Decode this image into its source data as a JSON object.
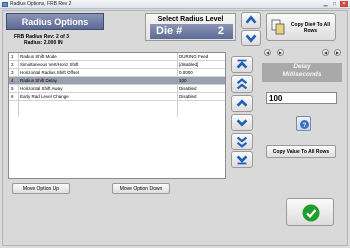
{
  "window": {
    "title": "Radius Options, FRB Rev 2"
  },
  "header": {
    "title": "Radius Options",
    "rev_line": "FRB Radius Rev:  2 of 3",
    "radius_line": "Radius:  2.000 IN"
  },
  "die_selector": {
    "label": "Select Radius Level",
    "prefix": "Die #",
    "value": "2"
  },
  "copy_die": {
    "label": "Copy Die# To All Rows"
  },
  "table": {
    "rows": [
      {
        "num": "1",
        "name": "Radius Shift Mode",
        "value": "DURING Feed"
      },
      {
        "num": "2",
        "name": "Simultaneous Vert/Horiz Shift",
        "value": "[disabled]"
      },
      {
        "num": "3",
        "name": "Horizontal Radius Shift Offset",
        "value": "0.0000"
      },
      {
        "num": "4",
        "name": "Radius Shift Delay",
        "value": "100",
        "selected": true
      },
      {
        "num": "5",
        "name": "Horizontal Shift Away",
        "value": "Disabled"
      },
      {
        "num": "6",
        "name": "Early Rad Level Change",
        "value": "Disabled"
      }
    ]
  },
  "buttons": {
    "move_up": "Move Option Up",
    "move_down": "Move Option Down"
  },
  "delay_panel": {
    "title_line1": "Delay",
    "title_line2": "Milliseconds",
    "value": "100",
    "copy_all": "Copy Value To All Rows"
  },
  "icons": {
    "app": "app-icon",
    "up": "arrow-up-icon",
    "down": "arrow-down-icon",
    "top": "arrow-top-icon",
    "bottom": "arrow-bottom-icon",
    "double_up": "double-arrow-up-icon",
    "double_down": "double-arrow-down-icon",
    "help": "help-icon",
    "ok": "checkmark-icon",
    "copy": "copy-icon"
  },
  "colors": {
    "accent": "#5c6a95",
    "selected_row": "#9aa0ad",
    "arrow": "#1f5fb6",
    "ok": "#1e9e2b"
  }
}
